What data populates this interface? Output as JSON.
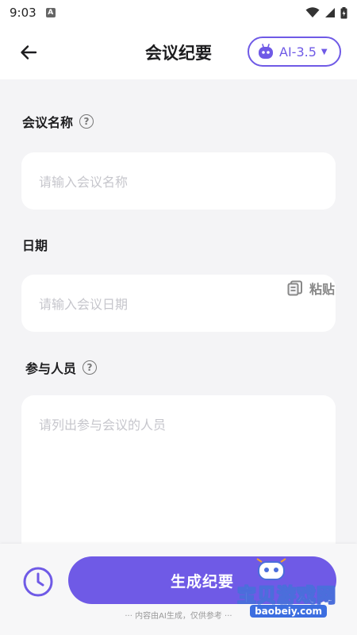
{
  "status": {
    "time": "9:03",
    "app_letter": "A"
  },
  "header": {
    "title": "会议纪要",
    "model_label": "AI-3.5"
  },
  "form": {
    "name": {
      "label": "会议名称",
      "placeholder": "请输入会议名称"
    },
    "date": {
      "label": "日期",
      "placeholder": "请输入会议日期"
    },
    "people": {
      "label": "参与人员",
      "placeholder": "请列出参与会议的人员",
      "paste_label": "粘贴"
    }
  },
  "footer": {
    "generate_label": "生成纪要",
    "disclaimer": "··· 内容由AI生成，仅供参考 ···"
  },
  "watermark": {
    "text": "宝贝游戏网",
    "url": "baobeiy.com"
  },
  "colors": {
    "accent": "#6f5ae6",
    "background": "#f4f4f6"
  },
  "icons": [
    "back-arrow-icon",
    "robot-icon",
    "caret-down-icon",
    "help-icon",
    "paste-icon",
    "history-clock-icon",
    "wifi-icon",
    "signal-icon",
    "battery-icon"
  ]
}
